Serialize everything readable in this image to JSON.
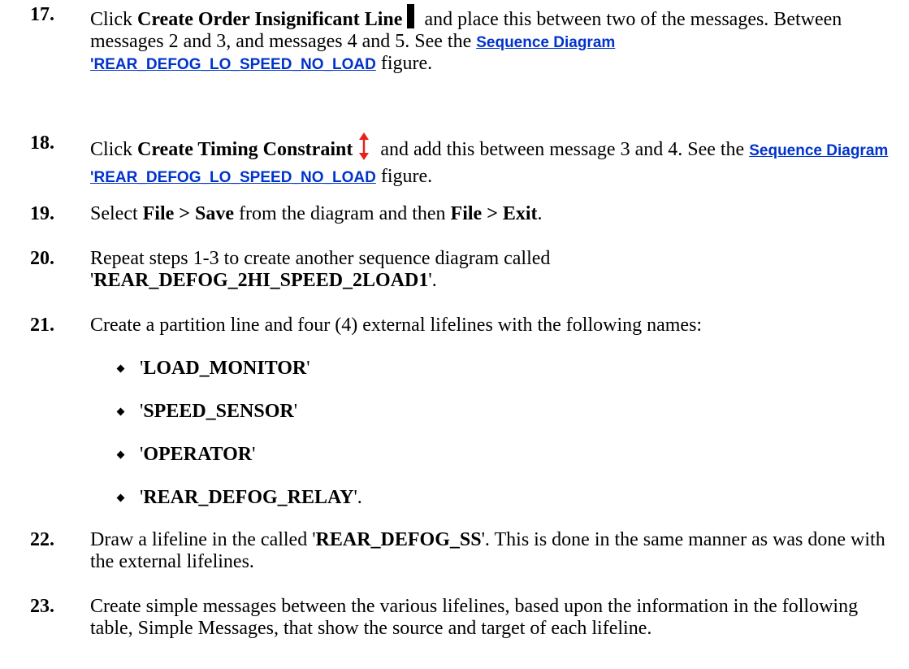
{
  "steps": [
    {
      "number": "17.",
      "pre": "Click ",
      "bold": "Create Order Insignificant Line",
      "icon": "vertical-bar-icon",
      "post": " and place this between two of the messages. Between messages 2 and 3, and messages 4 and 5. See the ",
      "link": "Sequence Diagram 'REAR_DEFOG_LO_SPEED_NO_LOAD",
      "tail": " figure."
    },
    {
      "number": "18.",
      "pre": "Click ",
      "bold": "Create Timing Constraint",
      "icon": "double-arrow-icon",
      "post": " and add this between message 3 and 4. See the ",
      "link": "Sequence Diagram 'REAR_DEFOG_LO_SPEED_NO_LOAD",
      "tail": " figure."
    },
    {
      "number": "19.",
      "t1": "Select ",
      "b1": "File > Save",
      "t2": " from the diagram and then ",
      "b2": "File > Exit",
      "t3": "."
    },
    {
      "number": "20.",
      "t1": "Repeat steps 1-3 to create another sequence diagram called ",
      "q1": "'",
      "b1": "REAR_DEFOG_2HI_SPEED_2LOAD1",
      "q2": "'."
    },
    {
      "number": "21.",
      "text": "Create a partition line and four (4) external lifelines with the following names:",
      "bullets": [
        {
          "pre": "'",
          "name": "LOAD_MONITOR",
          "post": "'"
        },
        {
          "pre": "'",
          "name": "SPEED_SENSOR",
          "post": "'"
        },
        {
          "pre": "'",
          "name": "OPERATOR",
          "post": "'"
        },
        {
          "pre": "'",
          "name": "REAR_DEFOG_RELAY",
          "post": "'."
        }
      ]
    },
    {
      "number": "22.",
      "t1": "Draw a lifeline in the called '",
      "b1": "REAR_DEFOG_SS",
      "t2": "'. This is done in the same manner as was done with the external lifelines."
    },
    {
      "number": "23.",
      "text": "Create simple messages between the various lifelines, based upon the information in the following table, Simple Messages, that show the source and target of each lifeline."
    }
  ],
  "colors": {
    "link": "#0033cc",
    "arrow": "#e8201a"
  }
}
